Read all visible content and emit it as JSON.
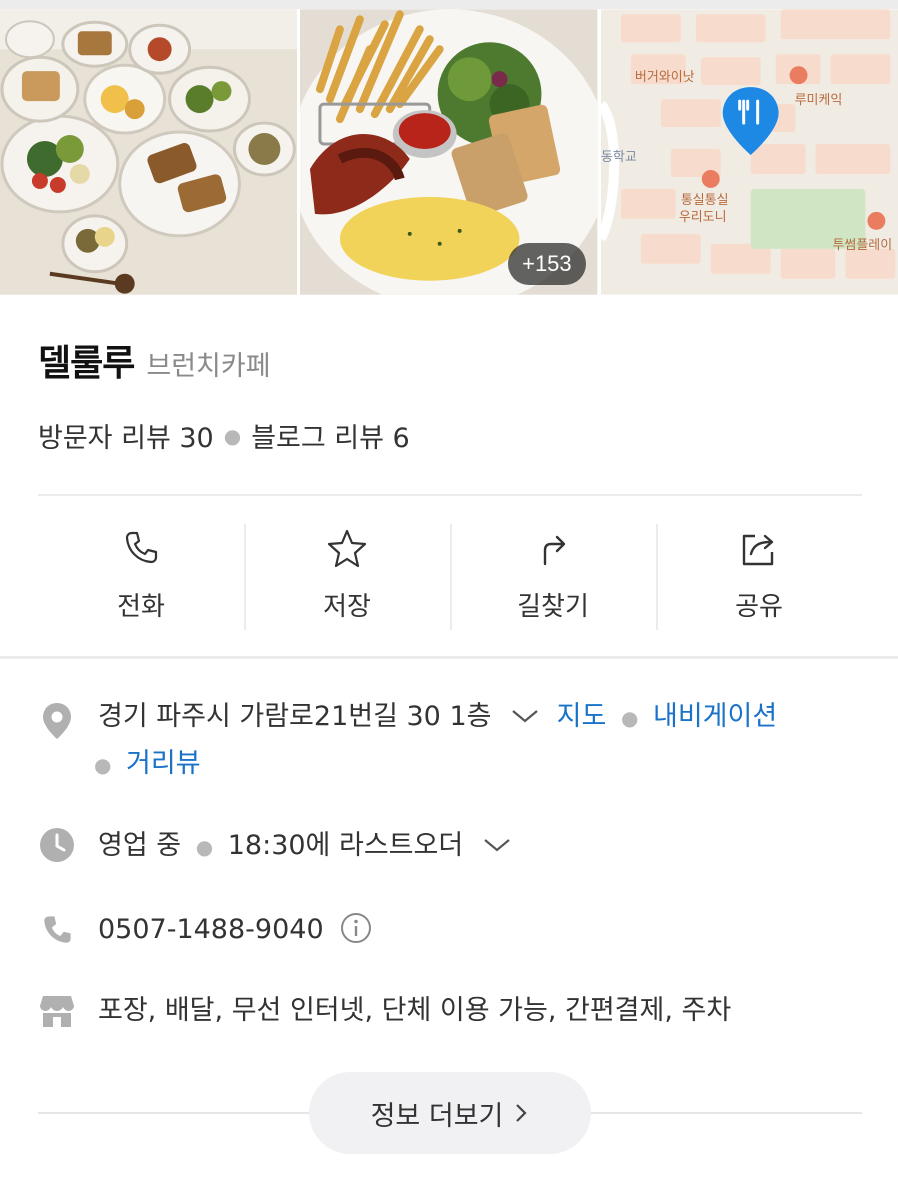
{
  "photos": {
    "count_badge": "+153",
    "map_labels": [
      "버거와이낫",
      "루미케익",
      "동학교",
      "통실통실",
      "우리도니",
      "투썸플레이"
    ]
  },
  "place": {
    "name": "델룰루",
    "category": "브런치카페",
    "visitor_reviews": "방문자 리뷰 30",
    "blog_reviews": "블로그 리뷰 6"
  },
  "actions": [
    {
      "label": "전화",
      "icon": "phone-icon"
    },
    {
      "label": "저장",
      "icon": "star-icon"
    },
    {
      "label": "길찾기",
      "icon": "directions-icon"
    },
    {
      "label": "공유",
      "icon": "share-icon"
    }
  ],
  "info": {
    "address": "경기 파주시 가람로21번길 30 1층",
    "map_link": "지도",
    "navi_link": "내비게이션",
    "street_link": "거리뷰",
    "hours_status": "영업 중",
    "hours_detail": "18:30에 라스트오더",
    "phone": "0507-1488-9040",
    "amenities": "포장, 배달, 무선 인터넷, 단체 이용 가능, 간편결제, 주차"
  },
  "more_button": "정보 더보기",
  "colors": {
    "link": "#1a73c9",
    "icon_gray": "#b0b0b0",
    "map_pin": "#1e88e5"
  }
}
